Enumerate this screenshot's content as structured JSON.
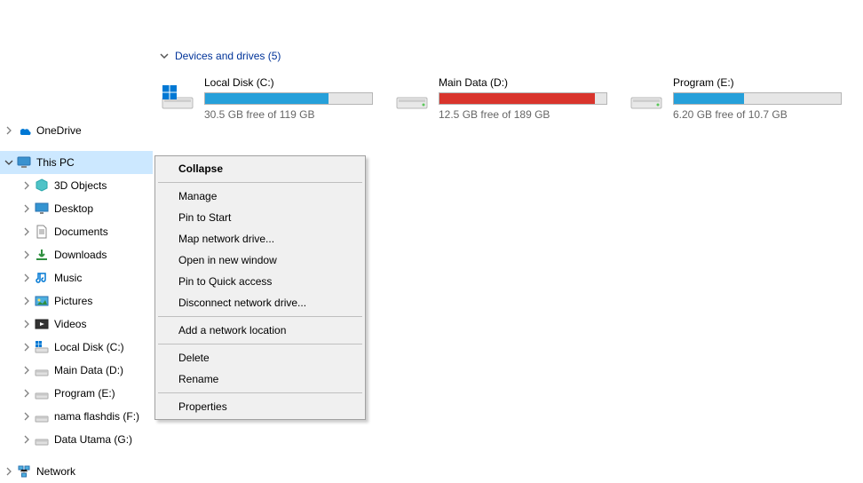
{
  "folder_icons": [
    1,
    2,
    3,
    4
  ],
  "sidebar": {
    "top": [
      {
        "indent": 4,
        "exp": ">",
        "icon": "onedrive",
        "label": "OneDrive"
      }
    ],
    "mid": [
      {
        "indent": 4,
        "exp": "v",
        "icon": "thispc",
        "label": "This PC",
        "selected": true
      },
      {
        "indent": 24,
        "exp": ">",
        "icon": "3d",
        "label": "3D Objects"
      },
      {
        "indent": 24,
        "exp": ">",
        "icon": "desktop",
        "label": "Desktop"
      },
      {
        "indent": 24,
        "exp": ">",
        "icon": "documents",
        "label": "Documents"
      },
      {
        "indent": 24,
        "exp": ">",
        "icon": "downloads",
        "label": "Downloads"
      },
      {
        "indent": 24,
        "exp": ">",
        "icon": "music",
        "label": "Music"
      },
      {
        "indent": 24,
        "exp": ">",
        "icon": "pictures",
        "label": "Pictures"
      },
      {
        "indent": 24,
        "exp": ">",
        "icon": "videos",
        "label": "Videos"
      },
      {
        "indent": 24,
        "exp": ">",
        "icon": "drive-win",
        "label": "Local Disk (C:)"
      },
      {
        "indent": 24,
        "exp": ">",
        "icon": "drive",
        "label": "Main Data (D:)"
      },
      {
        "indent": 24,
        "exp": ">",
        "icon": "drive",
        "label": "Program (E:)"
      },
      {
        "indent": 24,
        "exp": ">",
        "icon": "drive",
        "label": "nama flashdis (F:)"
      },
      {
        "indent": 24,
        "exp": ">",
        "icon": "drive",
        "label": "Data Utama (G:)"
      }
    ],
    "bottom": [
      {
        "indent": 4,
        "exp": ">",
        "icon": "network",
        "label": "Network"
      }
    ]
  },
  "section": {
    "title": "Devices and drives (5)"
  },
  "drives": [
    {
      "name": "Local Disk (C:)",
      "free": "30.5 GB free of 119 GB",
      "fill": 74,
      "red": false,
      "icon": "drive-win"
    },
    {
      "name": "Main Data (D:)",
      "free": "12.5 GB free of 189 GB",
      "fill": 93,
      "red": true,
      "icon": "drive"
    },
    {
      "name": "Program (E:)",
      "free": "6.20 GB free of 10.7 GB",
      "fill": 42,
      "red": false,
      "icon": "drive"
    }
  ],
  "context_menu": [
    {
      "type": "item",
      "label": "Collapse",
      "bold": true
    },
    {
      "type": "sep"
    },
    {
      "type": "item",
      "label": "Manage"
    },
    {
      "type": "item",
      "label": "Pin to Start"
    },
    {
      "type": "item",
      "label": "Map network drive..."
    },
    {
      "type": "item",
      "label": "Open in new window"
    },
    {
      "type": "item",
      "label": "Pin to Quick access"
    },
    {
      "type": "item",
      "label": "Disconnect network drive..."
    },
    {
      "type": "sep"
    },
    {
      "type": "item",
      "label": "Add a network location"
    },
    {
      "type": "sep"
    },
    {
      "type": "item",
      "label": "Delete"
    },
    {
      "type": "item",
      "label": "Rename"
    },
    {
      "type": "sep"
    },
    {
      "type": "item",
      "label": "Properties"
    }
  ]
}
